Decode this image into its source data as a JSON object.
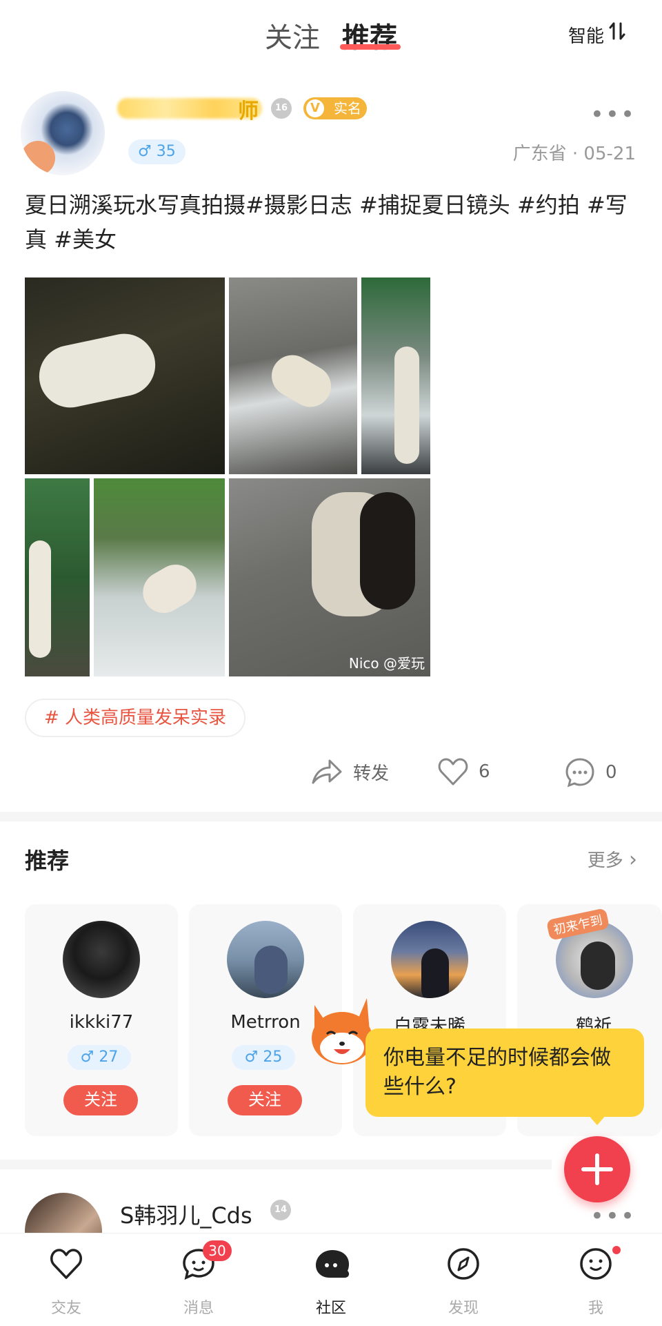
{
  "header": {
    "tabs": [
      {
        "label": "关注",
        "active": false
      },
      {
        "label": "推荐",
        "active": true
      }
    ],
    "sort_label": "智能"
  },
  "post": {
    "author_name_tail": "师",
    "level": "16",
    "verified_label": "实名",
    "gender_age": "♂ 35",
    "location_date": "广东省 · 05-21",
    "text": "夏日溯溪玩水写真拍摄#摄影日志 #捕捉夏日镜头 #约拍 #写真 #美女",
    "watermark": "Nico @爱玩",
    "topic": "# 人类高质量发呆实录",
    "actions": {
      "share_label": "转发",
      "like_count": "6",
      "comment_count": "0"
    }
  },
  "recommend": {
    "title": "推荐",
    "more_label": "更多",
    "users": [
      {
        "name": "ikkki77",
        "gender_age": "♂ 27",
        "follow_label": "关注"
      },
      {
        "name": "Metrron",
        "gender_age": "♂ 25",
        "follow_label": "关注"
      },
      {
        "name": "白露未晞"
      },
      {
        "name": "鹤祈",
        "frame_text": "初来乍到"
      }
    ]
  },
  "bubble": {
    "text": "你电量不足的时候都会做些什么?"
  },
  "next_post": {
    "author_name": "S韩羽儿_Cds",
    "level": "14"
  },
  "nav": {
    "items": [
      {
        "label": "交友",
        "icon": "heart-icon"
      },
      {
        "label": "消息",
        "icon": "chat-icon",
        "badge": "30"
      },
      {
        "label": "社区",
        "icon": "community-icon",
        "active": true
      },
      {
        "label": "发现",
        "icon": "compass-icon"
      },
      {
        "label": "我",
        "icon": "smile-icon",
        "dot": true
      }
    ]
  },
  "colors": {
    "accent": "#f15b4e",
    "tab_underline": "#ff5a5a",
    "gender_blue": "#4da3e8",
    "bubble_yellow": "#fdd23a",
    "verified_gold": "#f4b53a"
  }
}
